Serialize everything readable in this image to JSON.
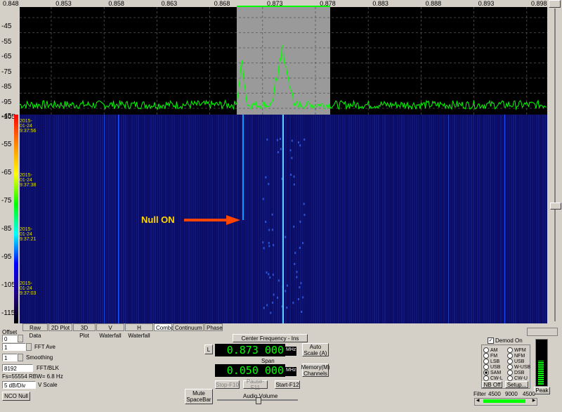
{
  "frequency_axis": [
    "0.848",
    "0.853",
    "0.858",
    "0.863",
    "0.868",
    "0.873",
    "0.878",
    "0.883",
    "0.888",
    "0.893",
    "0.898"
  ],
  "spectrum_db_labels": [
    "-45",
    "-55",
    "-65",
    "-75",
    "-85",
    "-95",
    "-105"
  ],
  "waterfall_db_labels": [
    "-45",
    "-55",
    "-65",
    "-75",
    "-85",
    "-95",
    "-105",
    "-115"
  ],
  "timestamps": [
    "2015-01-24 9:37:56",
    "2015-01-24 9:37:38",
    "2015-01-24 9:37:21",
    "2015-01-24 9:37:03"
  ],
  "annotation": {
    "text": "Null ON",
    "color": "#ffd700",
    "arrow_color": "#ff4500"
  },
  "colors": {
    "signal": "#00ff00",
    "waterfall_bg": "#0a0a60",
    "selection": "#9a9a9a"
  },
  "tabs": [
    {
      "label": "Raw Data"
    },
    {
      "label": "2D Plot"
    },
    {
      "label": "3D Plot"
    },
    {
      "label": "V Waterfall"
    },
    {
      "label": "H Waterfall"
    },
    {
      "label": "Combo"
    },
    {
      "label": "Continuum"
    },
    {
      "label": "Phase"
    }
  ],
  "active_tab": "Combo",
  "controls": {
    "offset_label": "Offset",
    "offset_value": "0",
    "fft_ave_value": "1",
    "fft_ave_label": "FFT Ave",
    "smoothing_value": "1",
    "smoothing_label": "Smoothing",
    "fft_blk_value": "8192",
    "fft_blk_label": "FFT/BLK",
    "fs_text": "Fs=55554 RBW= 6.8 Hz",
    "vscale_value": "5 dB/Div",
    "vscale_label": "V Scale",
    "nco_null": "NCO Null",
    "mute": "Mute SpaceBar"
  },
  "tuning": {
    "center_freq_button": "Center Frequency - Ins",
    "l_button": "L",
    "frequency": "0.873 000",
    "freq_unit": "MHz",
    "auto_scale": "Auto Scale (A)",
    "span_label": "Span",
    "span": "0.050 000",
    "span_unit": "MHz",
    "memory": "Memory(M) Channels",
    "stop": "Stop-F10",
    "pause": "Pause-F11",
    "start": "Start-F12",
    "audio_volume": "Audio Volume"
  },
  "demod": {
    "demod_on_label": "Demod On",
    "demod_on": true,
    "modes_left": [
      "AM",
      "FM",
      "LSB",
      "USB",
      "SAM",
      "CW-L"
    ],
    "modes_right": [
      "WFM",
      "NFM",
      "USB",
      "W-USB",
      "DSB",
      "CW-U"
    ],
    "selected": "SAM",
    "nb_off": "NB Off",
    "setup": "Setup...",
    "peak": "Peak",
    "filter_label": "Filter",
    "filter_low": "4500",
    "filter_width": "9000",
    "filter_high": "4500",
    "signal_level": 0.55
  }
}
